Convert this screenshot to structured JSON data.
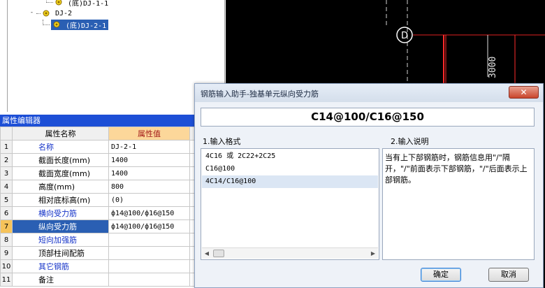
{
  "tree": {
    "items": [
      {
        "label": "(底)DJ-1-1",
        "level": 2,
        "selected": false
      },
      {
        "label": "DJ-2",
        "level": 1,
        "selected": false,
        "expander": "-"
      },
      {
        "label": "(底)DJ-2-1",
        "level": 2,
        "selected": true
      }
    ]
  },
  "cad": {
    "axis_label": "D",
    "dimension_text": "3000",
    "colors": {
      "background": "#000000",
      "axis_line": "#e02020",
      "grid_line": "#ffffff",
      "wall": "#ff2a2a"
    }
  },
  "property_editor": {
    "title": "属性编辑器",
    "col_name": "属性名称",
    "col_value": "属性值",
    "rows": [
      {
        "idx": "1",
        "name": "名称",
        "value": "DJ-2-1",
        "link": true
      },
      {
        "idx": "2",
        "name": "截面长度(mm)",
        "value": "1400",
        "link": false
      },
      {
        "idx": "3",
        "name": "截面宽度(mm)",
        "value": "1400",
        "link": false
      },
      {
        "idx": "4",
        "name": "高度(mm)",
        "value": "800",
        "link": false
      },
      {
        "idx": "5",
        "name": "相对底标高(m)",
        "value": "(0)",
        "link": false
      },
      {
        "idx": "6",
        "name": "横向受力筋",
        "value": "ф14@100/ф16@150",
        "link": true
      },
      {
        "idx": "7",
        "name": "纵向受力筋",
        "value": "ф14@100/ф16@150",
        "link": true,
        "selected": true
      },
      {
        "idx": "8",
        "name": "短向加强筋",
        "value": "",
        "link": true
      },
      {
        "idx": "9",
        "name": "顶部柱间配筋",
        "value": "",
        "link": false
      },
      {
        "idx": "10",
        "name": "其它钢筋",
        "value": "",
        "link": true
      },
      {
        "idx": "11",
        "name": "备注",
        "value": "",
        "link": false
      }
    ]
  },
  "dialog": {
    "title": "钢筋输入助手-独基单元纵向受力筋",
    "close_label": "✕",
    "format_display": "C14@100/C16@150",
    "section1_label": "1.输入格式",
    "section2_label": "2.输入说明",
    "formats": [
      {
        "text": "4C16 或 2C22+2C25",
        "selected": false
      },
      {
        "text": "C16@100",
        "selected": false
      },
      {
        "text": "4C14/C16@100",
        "selected": true
      }
    ],
    "description": "当有上下部钢筋时，钢筋信息用\"/\"隔开，\"/\"前面表示下部钢筋，\"/\"后面表示上部钢筋。",
    "ok_label": "确定",
    "cancel_label": "取消"
  }
}
